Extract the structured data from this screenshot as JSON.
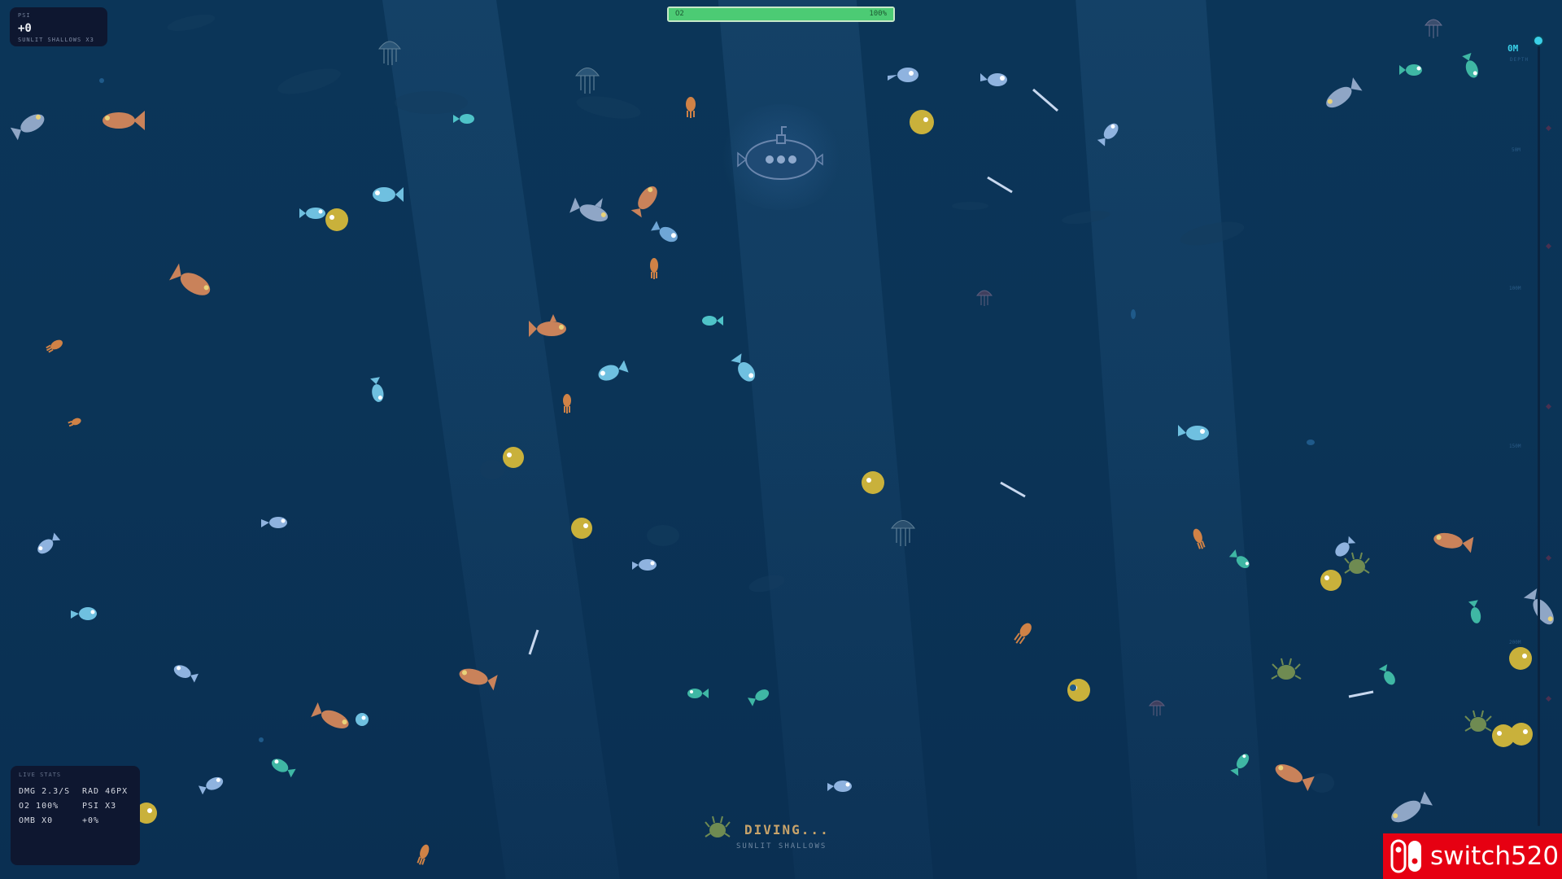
{
  "hud": {
    "score_label": "PSI",
    "score_value": "+0",
    "zone_multiplier": "SUNLIT SHALLOWS X3"
  },
  "oxygen": {
    "label": "O2",
    "percent_text": "100%",
    "level": 1.0,
    "color": "#4ccb74"
  },
  "depth_gauge": {
    "depth": "0M",
    "label": "DEPTH",
    "marks": [
      "50M",
      "100M",
      "150M",
      "200M"
    ],
    "accent": "#3ad0e8"
  },
  "live_stats": {
    "title": "LIVE STATS",
    "dmg": "DMG 2.3/S",
    "rad": "RAD 46PX",
    "o2": "O2 100%",
    "psi": "PSI X3",
    "omb": "OMB X0",
    "bonus": "+0%"
  },
  "status": {
    "main": "DIVING...",
    "sub": "SUNLIT SHALLOWS"
  },
  "watermark": {
    "text": "switch520",
    "color": "#e60012"
  },
  "colors": {
    "ocean": "#0b3558",
    "fish_blue": "#6fa6d6",
    "fish_cyan": "#4fc3dd",
    "fish_orange": "#c9825a",
    "fish_teal": "#3fb7a4",
    "puffer_yellow": "#c9b13b",
    "shark_grey": "#8fa6c6"
  }
}
